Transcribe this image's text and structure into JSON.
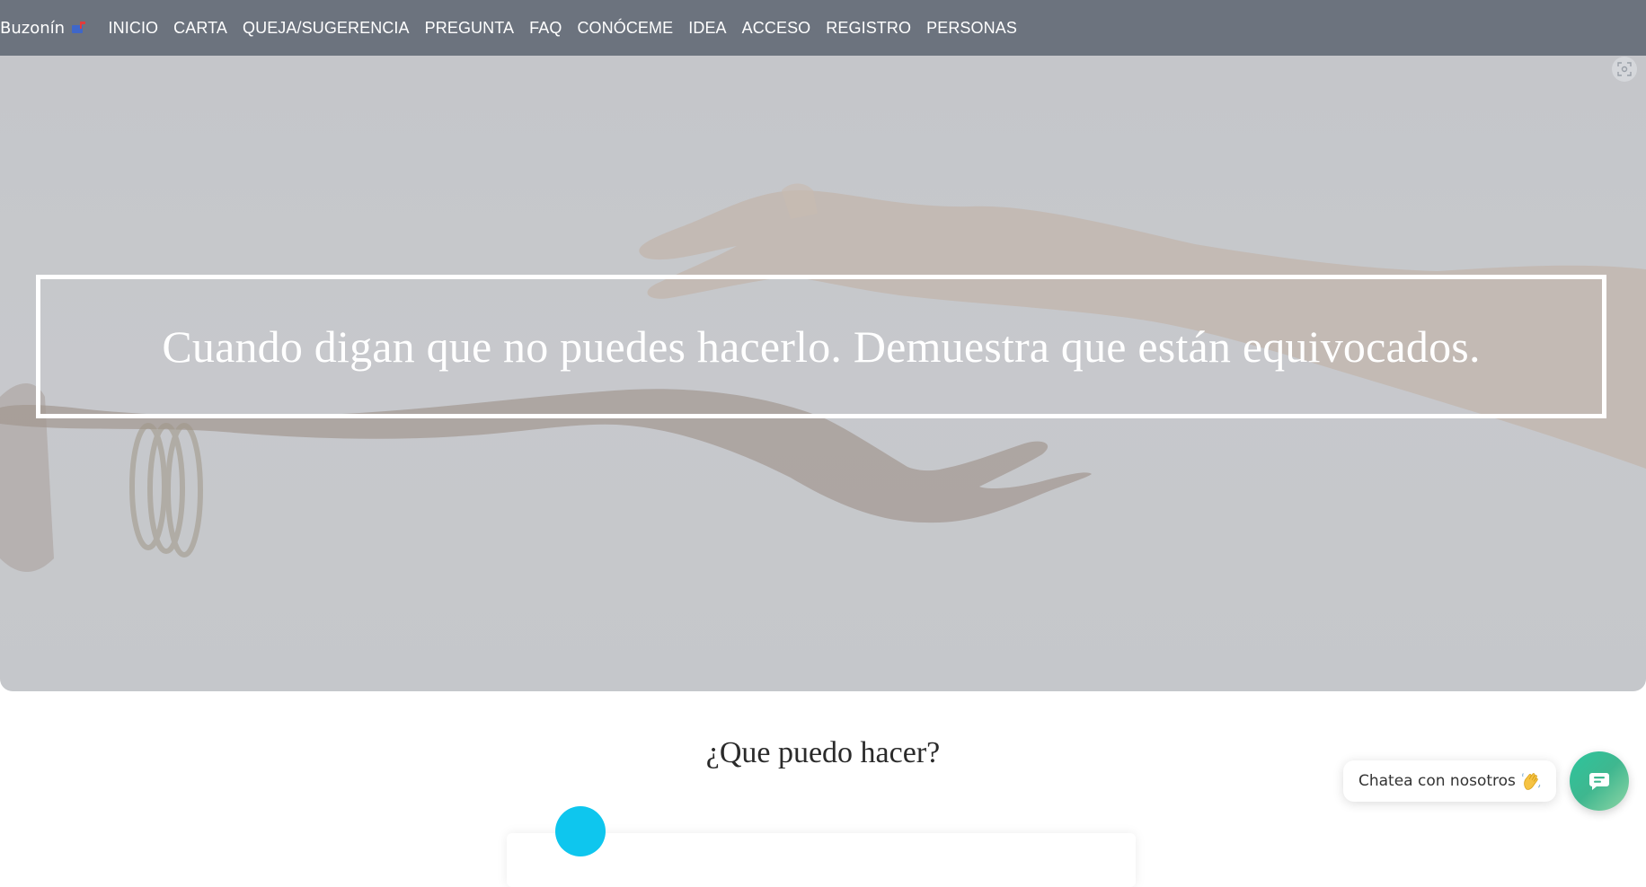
{
  "nav": {
    "brand": "Buzonín",
    "brand_icon": "mailbox-icon",
    "links": [
      "INICIO",
      "CARTA",
      "QUEJA/SUGERENCIA",
      "PREGUNTA",
      "FAQ",
      "CONÓCEME",
      "IDEA",
      "ACCESO",
      "REGISTRO",
      "PERSONAS"
    ]
  },
  "hero": {
    "quote": "Cuando digan que no puedes hacerlo. Demuestra que están equivocados.",
    "corner_icon": "screenshot-icon"
  },
  "section": {
    "title": "¿Que puedo hacer?"
  },
  "chat": {
    "label": "Chatea con nosotros",
    "wave_icon": "waving-hand-icon",
    "button_icon": "chat-icon"
  },
  "colors": {
    "navbar": "#6c737e",
    "accent_dot": "#0ec6ee",
    "chat_button": "#2cc59d"
  }
}
